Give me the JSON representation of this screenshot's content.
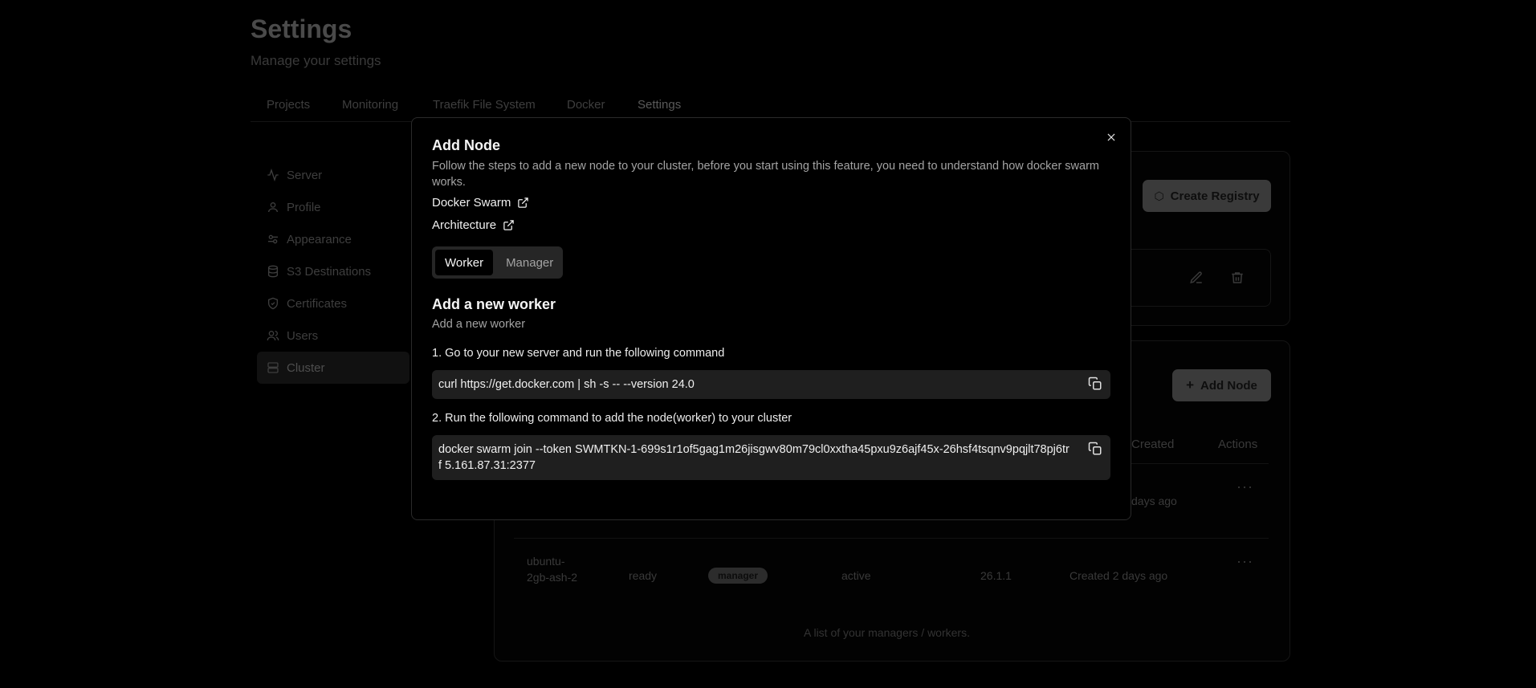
{
  "page": {
    "title": "Settings",
    "subtitle": "Manage your settings",
    "tabs": [
      {
        "label": "Projects"
      },
      {
        "label": "Monitoring"
      },
      {
        "label": "Traefik File System"
      },
      {
        "label": "Docker"
      },
      {
        "label": "Settings"
      }
    ],
    "sidebar": [
      {
        "label": "Server",
        "icon": "activity-icon"
      },
      {
        "label": "Profile",
        "icon": "user-icon"
      },
      {
        "label": "Appearance",
        "icon": "palette-icon"
      },
      {
        "label": "S3 Destinations",
        "icon": "database-icon"
      },
      {
        "label": "Certificates",
        "icon": "shield-check-icon"
      },
      {
        "label": "Users",
        "icon": "users-icon"
      },
      {
        "label": "Cluster",
        "icon": "server-icon"
      }
    ],
    "create_registry_label": "Create Registry",
    "add_node_label": "Add Node",
    "table": {
      "headers": {
        "created": "Created",
        "actions": "Actions"
      },
      "row1": {
        "created": "days ago"
      },
      "row2": {
        "hostname": "ubuntu-2gb-ash-2",
        "status": "ready",
        "role": "manager",
        "availability": "active",
        "engine": "26.1.1",
        "created": "Created 2 days ago"
      },
      "caption": "A list of your managers / workers."
    }
  },
  "modal": {
    "title": "Add Node",
    "description": "Follow the steps to add a new node to your cluster, before you start using this feature, you need to understand how docker swarm works.",
    "links": [
      {
        "label": "Docker Swarm"
      },
      {
        "label": "Architecture"
      }
    ],
    "tabs": {
      "worker": "Worker",
      "manager": "Manager",
      "selected": "Worker"
    },
    "section_title": "Add a new worker",
    "section_subtitle": "Add a new worker",
    "step1": "1. Go to your new server and run the following command",
    "command1": "curl https://get.docker.com | sh -s -- --version 24.0",
    "step2": "2. Run the following command to add the node(worker) to your cluster",
    "command2": "docker swarm join --token SWMTKN-1-699s1r1of5gag1m26jisgwv80m79cl0xxtha45pxu9z6ajf45x-26hsf4tsqnv9pqjlt78pj6trf 5.161.87.31:2377"
  }
}
